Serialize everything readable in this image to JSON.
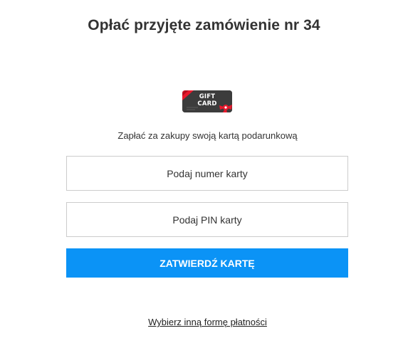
{
  "header": {
    "title": "Opłać przyjęte zamówienie nr 34"
  },
  "gift_card_logo": {
    "line1": "GIFT",
    "line2": "CARD",
    "colors": {
      "card": "#3c3c3c",
      "ribbon": "#e8192c"
    }
  },
  "form": {
    "subtitle": "Zapłać za zakupy swoją kartą podarunkową",
    "card_number_placeholder": "Podaj numer karty",
    "pin_placeholder": "Podaj PIN karty",
    "submit_label": "ZATWIERDŹ KARTĘ"
  },
  "footer": {
    "other_method_link": "Wybierz inną formę płatności"
  },
  "colors": {
    "accent": "#0b93f6",
    "border": "#cccccc",
    "text": "#333333"
  }
}
